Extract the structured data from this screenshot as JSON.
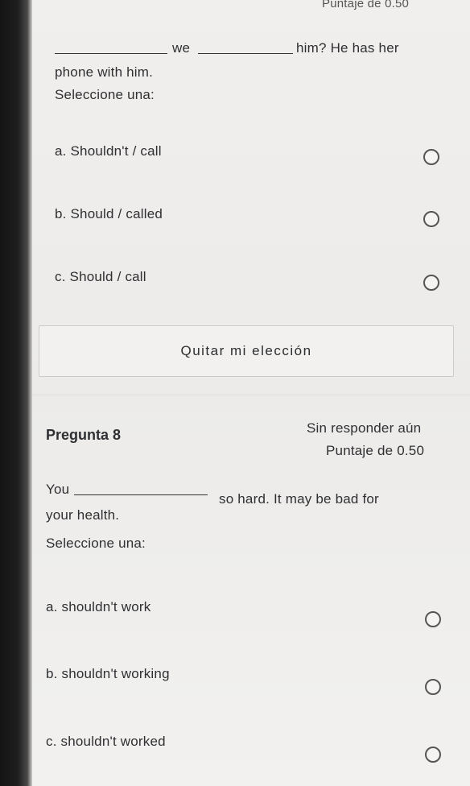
{
  "q7": {
    "score_top": "Puntaje de 0.50",
    "line1_we": "we",
    "line1_rest": "him? He has her",
    "line2": "phone with him.",
    "select_prompt": "Seleccione una:",
    "options": [
      "a. Shouldn't / call",
      "b.  Should / called",
      "c. Should / call"
    ],
    "clear_label": "Quitar mi elección"
  },
  "q8": {
    "title": "Pregunta 8",
    "status": "Sin responder aún",
    "score": "Puntaje de 0.50",
    "line1_you": "You",
    "line1_rest": "so hard. It may be bad for",
    "line2": "your health.",
    "select_prompt": "Seleccione una:",
    "options": [
      "a. shouldn't work",
      "b. shouldn't working",
      "c. shouldn't worked"
    ]
  }
}
